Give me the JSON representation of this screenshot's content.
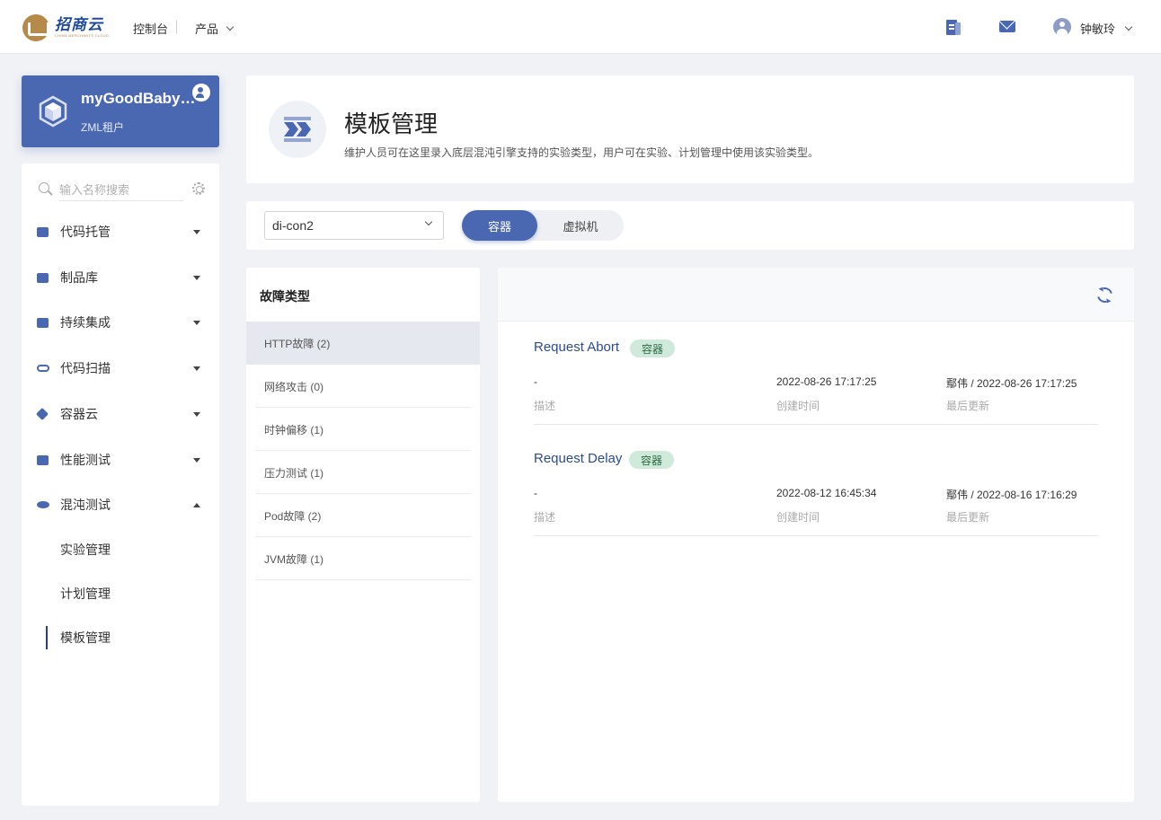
{
  "topbar": {
    "logo_cn": "招商云",
    "logo_en": "CHINA MERCHANTS CLOUD",
    "console": "控制台",
    "product": "产品",
    "user": "钟敏玲"
  },
  "tenant": {
    "name": "myGoodBaby-z...",
    "subtitle": "ZML租户"
  },
  "sidebar": {
    "search_placeholder": "输入名称搜索",
    "items": [
      {
        "label": "代码托管"
      },
      {
        "label": "制品库"
      },
      {
        "label": "持续集成"
      },
      {
        "label": "代码扫描"
      },
      {
        "label": "容器云"
      },
      {
        "label": "性能测试"
      },
      {
        "label": "混沌测试"
      }
    ],
    "sub_items": [
      {
        "label": "实验管理"
      },
      {
        "label": "计划管理"
      },
      {
        "label": "模板管理"
      }
    ]
  },
  "header": {
    "title": "模板管理",
    "description": "维护人员可在这里录入底层混沌引擎支持的实验类型，用户可在实验、计划管理中使用该实验类型。"
  },
  "filter": {
    "selected": "di-con2",
    "seg_active": "容器",
    "seg_other": "虚拟机"
  },
  "faults": {
    "title": "故障类型",
    "items": [
      {
        "label": "HTTP故障  (2)"
      },
      {
        "label": "网络攻击  (0)"
      },
      {
        "label": "时钟偏移  (1)"
      },
      {
        "label": "压力测试  (1)"
      },
      {
        "label": "Pod故障  (2)"
      },
      {
        "label": "JVM故障  (1)"
      }
    ]
  },
  "templates": [
    {
      "name": "Request Abort",
      "tag": "容器",
      "description": "-",
      "description_label": "描述",
      "created": "2022-08-26 17:17:25",
      "created_label": "创建时间",
      "updated": "鄢伟 / 2022-08-26 17:17:25",
      "updated_label": "最后更新"
    },
    {
      "name": "Request Delay",
      "tag": "容器",
      "description": "-",
      "description_label": "描述",
      "created": "2022-08-12 16:45:34",
      "created_label": "创建时间",
      "updated": "鄢伟 / 2022-08-16 17:16:29",
      "updated_label": "最后更新"
    }
  ],
  "colors": {
    "brand": "#4a67b1",
    "tag_bg": "#cfe9da",
    "link": "#2b4a94"
  }
}
